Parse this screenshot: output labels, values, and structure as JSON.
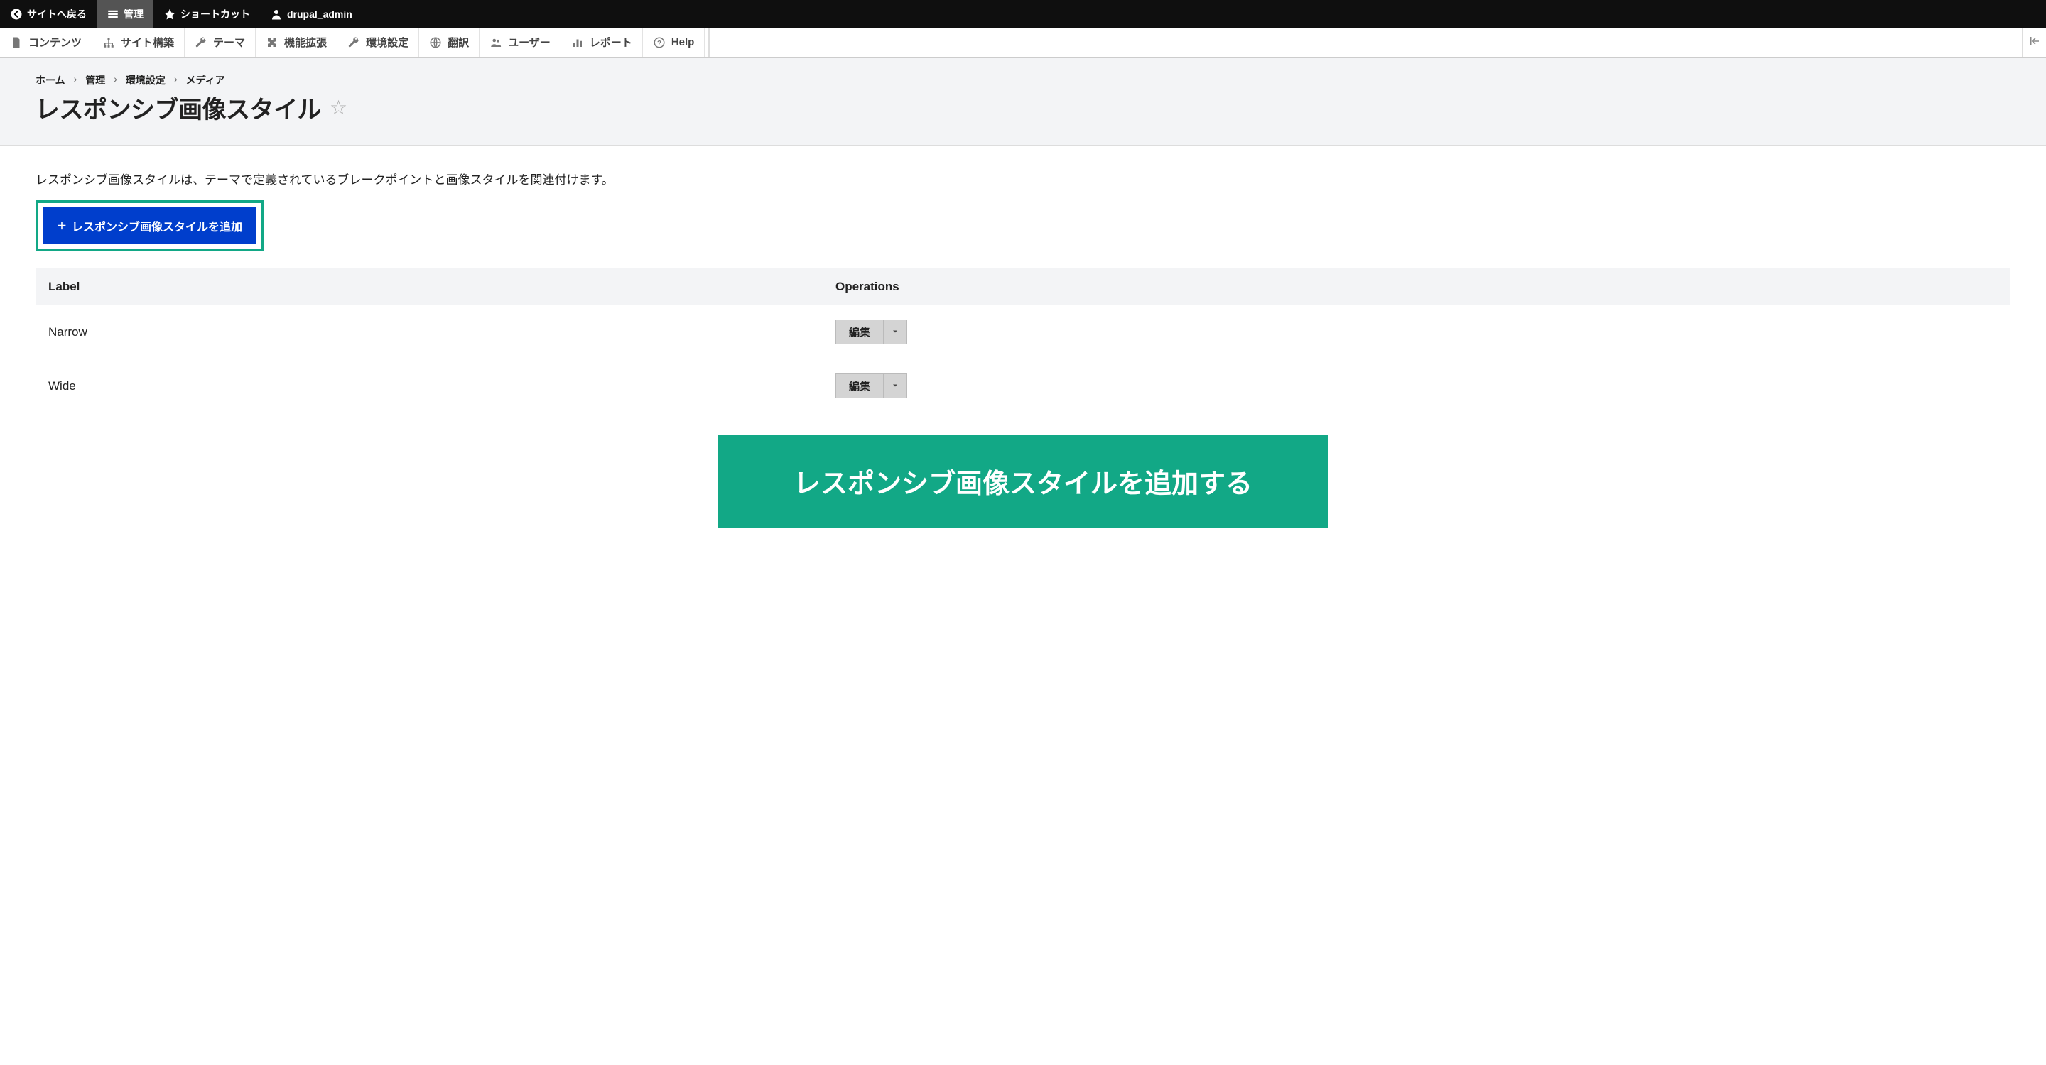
{
  "topbar": {
    "back_to_site": "サイトへ戻る",
    "manage": "管理",
    "shortcuts": "ショートカット",
    "username": "drupal_admin"
  },
  "admin_menu": {
    "content": "コンテンツ",
    "structure": "サイト構築",
    "appearance": "テーマ",
    "extend": "機能拡張",
    "configuration": "環境設定",
    "translate": "翻訳",
    "people": "ユーザー",
    "reports": "レポート",
    "help": "Help"
  },
  "breadcrumb": [
    "ホーム",
    "管理",
    "環境設定",
    "メディア"
  ],
  "page_title": "レスポンシブ画像スタイル",
  "description": "レスポンシブ画像スタイルは、テーマで定義されているブレークポイントと画像スタイルを関連付けます。",
  "add_button": "レスポンシブ画像スタイルを追加",
  "table": {
    "headers": {
      "label": "Label",
      "operations": "Operations"
    },
    "rows": [
      {
        "label": "Narrow",
        "op": "編集"
      },
      {
        "label": "Wide",
        "op": "編集"
      }
    ]
  },
  "banner": "レスポンシブ画像スタイルを追加する"
}
